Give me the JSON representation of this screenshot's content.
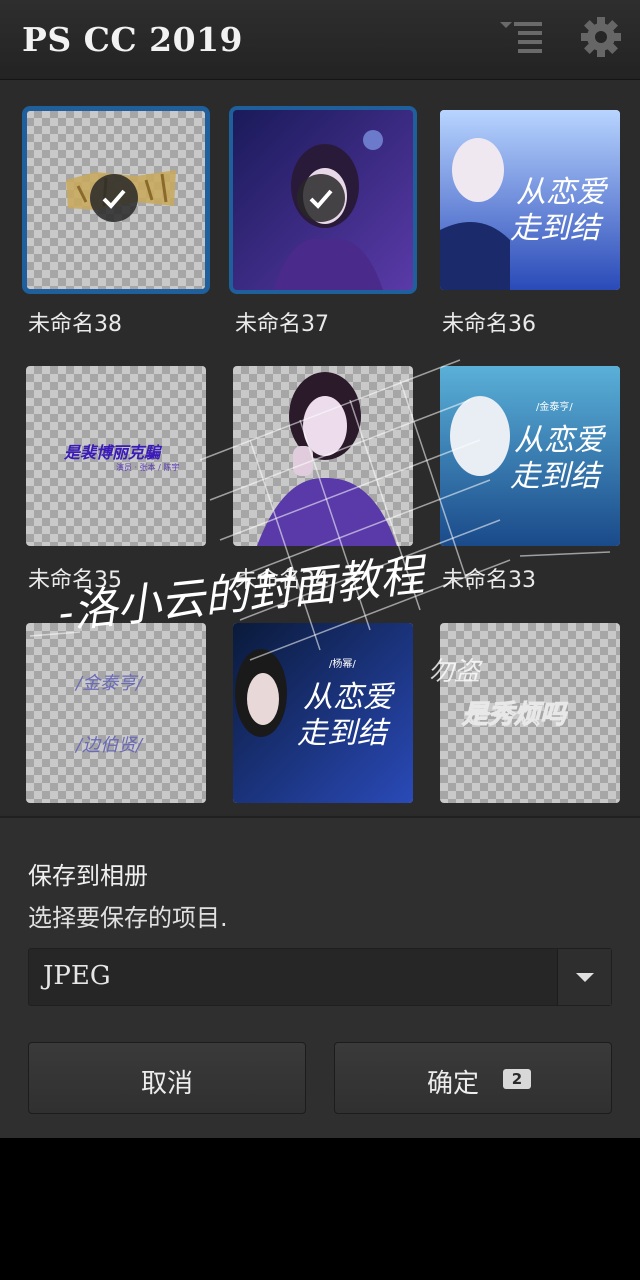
{
  "app": {
    "title": "PS CC 2019"
  },
  "header": {
    "list_icon": "list-menu-icon",
    "settings_icon": "gear-icon"
  },
  "projects": [
    {
      "name": "未命名38",
      "selected": true
    },
    {
      "name": "未命名37",
      "selected": true
    },
    {
      "name": "未命名36",
      "selected": false
    },
    {
      "name": "未命名35",
      "selected": false
    },
    {
      "name": "未命名34",
      "selected": false
    },
    {
      "name": "未命名33",
      "selected": false
    },
    {
      "name": "",
      "selected": false
    },
    {
      "name": "",
      "selected": false
    },
    {
      "name": "",
      "selected": false
    }
  ],
  "thumbnail_text": {
    "t36_line1": "从恋爱",
    "t36_line2": "走到结",
    "t35_line1": "是裴博丽克騙",
    "t35_line2": "演员 · 张本 / 陈宇",
    "t33_tag": "/金泰亨/",
    "t33_line1": "从恋爱",
    "t33_line2": "走到结",
    "t39_line1": "/金泰亨/",
    "t39_line2": "/边伯贤/",
    "t40_tag": "/杨幂/",
    "t40_line1": "从恋爱",
    "t40_line2": "走到结",
    "t41_line1": "是秀烦吗"
  },
  "watermark": {
    "main": "-洛小云的封面教程",
    "note": "勿盗"
  },
  "save_panel": {
    "title": "保存到相册",
    "subtitle": "选择要保存的项目.",
    "format": "JPEG",
    "cancel_label": "取消",
    "confirm_label": "确定",
    "selected_count": "2"
  },
  "colors": {
    "accent": "#1e5f9c",
    "background": "#2a2a2a",
    "panel": "#2f2f2f"
  }
}
